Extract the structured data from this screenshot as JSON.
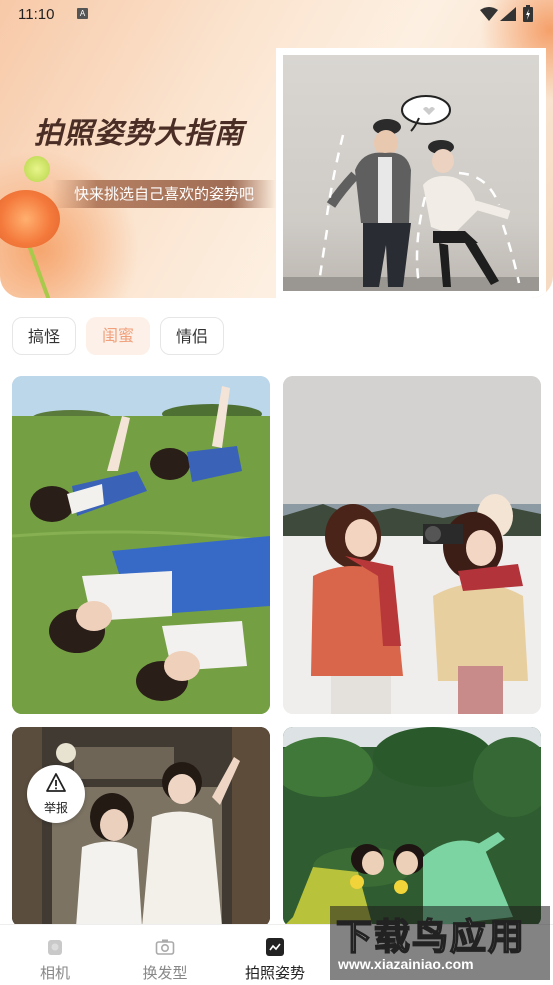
{
  "status_bar": {
    "time": "11:10",
    "a_icon_letter": "A"
  },
  "banner": {
    "title": "拍照姿势大指南",
    "subtitle": "快来挑选自己喜欢的姿势吧"
  },
  "filter_tabs": [
    {
      "label": "搞怪",
      "active": false
    },
    {
      "label": "闺蜜",
      "active": true
    },
    {
      "label": "情侣",
      "active": false
    }
  ],
  "report_button": {
    "label": "举报",
    "icon": "warning-icon"
  },
  "bottom_nav": [
    {
      "label": "相机",
      "icon": "camera-icon",
      "active": false
    },
    {
      "label": "换发型",
      "icon": "photo-camera-icon",
      "active": false
    },
    {
      "label": "拍照姿势",
      "icon": "pose-icon",
      "active": true
    }
  ],
  "watermark": {
    "big": "下载鸟应用",
    "small": "www.xiazainiao.com"
  },
  "colors": {
    "accent": "#f0a07a",
    "active_tab_bg": "#fdf0e8",
    "nav_active": "#222222",
    "nav_inactive": "#888888"
  }
}
